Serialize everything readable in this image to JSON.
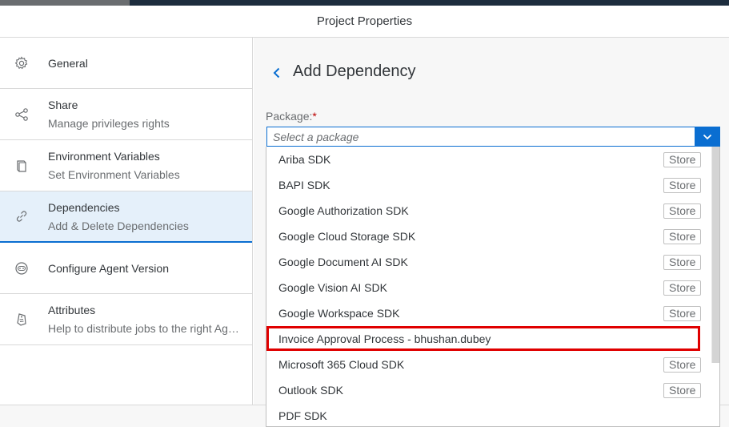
{
  "window": {
    "title": "Project Properties"
  },
  "sidebar": {
    "items": [
      {
        "title": "General",
        "subtitle": ""
      },
      {
        "title": "Share",
        "subtitle": "Manage privileges rights"
      },
      {
        "title": "Environment Variables",
        "subtitle": "Set Environment Variables"
      },
      {
        "title": "Dependencies",
        "subtitle": "Add & Delete Dependencies"
      },
      {
        "title": "Configure Agent Version",
        "subtitle": ""
      },
      {
        "title": "Attributes",
        "subtitle": "Help to distribute jobs to the right Agents"
      }
    ]
  },
  "main": {
    "title": "Add Dependency",
    "package_label": "Package:",
    "required_mark": "*",
    "select_placeholder": "Select a package"
  },
  "dropdown": {
    "options": [
      {
        "label": "Ariba SDK",
        "tag": "Store"
      },
      {
        "label": "BAPI SDK",
        "tag": "Store"
      },
      {
        "label": "Google Authorization SDK",
        "tag": "Store"
      },
      {
        "label": "Google Cloud Storage SDK",
        "tag": "Store"
      },
      {
        "label": "Google Document AI SDK",
        "tag": "Store"
      },
      {
        "label": "Google Vision AI SDK",
        "tag": "Store"
      },
      {
        "label": "Google Workspace SDK",
        "tag": "Store"
      },
      {
        "label": "Invoice Approval Process - bhushan.dubey",
        "tag": ""
      },
      {
        "label": "Microsoft 365 Cloud SDK",
        "tag": "Store"
      },
      {
        "label": "Outlook SDK",
        "tag": "Store"
      },
      {
        "label": "PDF SDK",
        "tag": ""
      }
    ]
  },
  "colors": {
    "accent": "#0a6ed1",
    "highlight": "#e00000",
    "active_bg": "#e5f0fa"
  }
}
